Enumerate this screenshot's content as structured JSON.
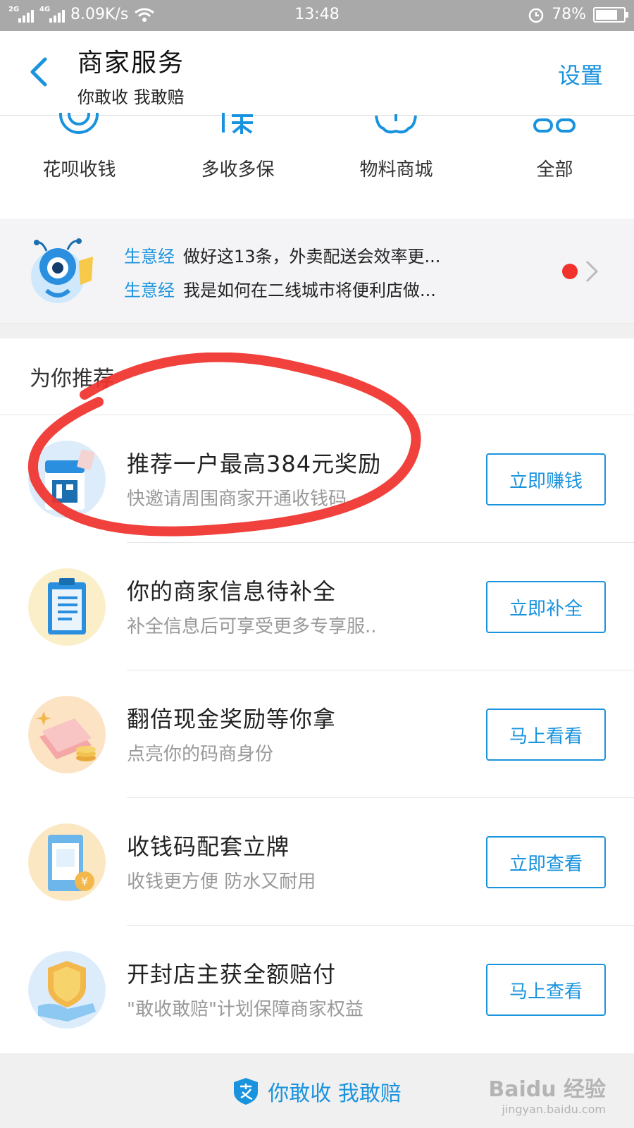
{
  "status_bar": {
    "network_1": "2G",
    "network_2": "4G",
    "speed": "8.09K/s",
    "time": "13:48",
    "battery": "78%",
    "battery_level": 0.78
  },
  "header": {
    "title": "商家服务",
    "subtitle": "你敢收 我敢赔",
    "settings_label": "设置"
  },
  "quick_actions": [
    {
      "label": "花呗收钱",
      "icon": "huabei-icon"
    },
    {
      "label": "多收多保",
      "icon": "bao-icon"
    },
    {
      "label": "物料商城",
      "icon": "shop-icon"
    },
    {
      "label": "全部",
      "icon": "all-icon"
    }
  ],
  "news": {
    "items": [
      {
        "tag": "生意经",
        "text": "做好这13条，外卖配送会效率更..."
      },
      {
        "tag": "生意经",
        "text": "我是如何在二线城市将便利店做..."
      }
    ]
  },
  "recommend": {
    "title": "为你推荐",
    "items": [
      {
        "title": "推荐一户最高384元奖励",
        "desc": "快邀请周围商家开通收钱码",
        "button": "立即赚钱",
        "icon": "qr-card-icon"
      },
      {
        "title": "你的商家信息待补全",
        "desc": "补全信息后可享受更多专享服..",
        "button": "立即补全",
        "icon": "clipboard-icon"
      },
      {
        "title": "翻倍现金奖励等你拿",
        "desc": "点亮你的码商身份",
        "button": "马上看看",
        "icon": "cash-icon"
      },
      {
        "title": "收钱码配套立牌",
        "desc": "收钱更方便 防水又耐用",
        "button": "立即查看",
        "icon": "stand-icon"
      },
      {
        "title": "开封店主获全额赔付",
        "desc": "\"敢收敢赔\"计划保障商家权益",
        "button": "马上查看",
        "icon": "shield-icon"
      }
    ]
  },
  "footer": {
    "text": "你敢收 我敢赔"
  },
  "watermark": {
    "brand": "Baidu 经验",
    "url": "jingyan.baidu.com"
  },
  "colors": {
    "accent": "#1a93de",
    "annotation": "#f0312c"
  }
}
